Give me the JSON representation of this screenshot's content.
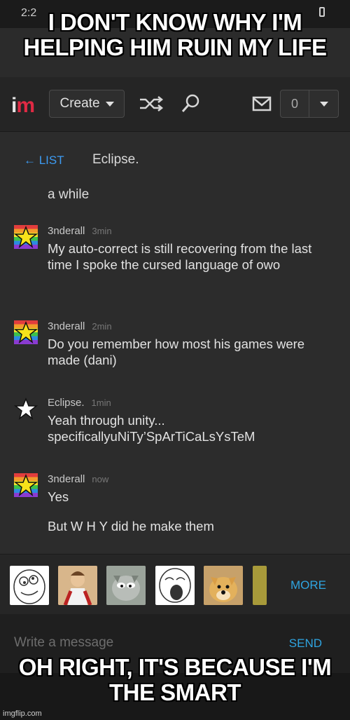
{
  "meme": {
    "top_text": "I DON'T KNOW WHY I'M HELPING HIM RUIN MY LIFE",
    "bottom_text": "OH RIGHT, IT'S BECAUSE I'M THE SMART",
    "watermark": "imgflip.com"
  },
  "statusbar": {
    "time": "2:2"
  },
  "navbar": {
    "logo_i": "i",
    "logo_m": "m",
    "create_label": "Create",
    "notification_count": "0",
    "icons": [
      "shuffle-icon",
      "search-icon",
      "mail-icon",
      "chevron-down-icon"
    ]
  },
  "chat": {
    "back_label": "← LIST",
    "title": "Eclipse.",
    "previous_text": "a while",
    "messages": [
      {
        "user": "3nderall",
        "time": "3min",
        "avatar": "rainbow-star",
        "text": "My auto-correct is still recovering from the last time I spoke the cursed language of owo"
      },
      {
        "user": "3nderall",
        "time": "2min",
        "avatar": "rainbow-star",
        "text": "Do you remember how most his games were made (dani)"
      },
      {
        "user": "Eclipse.",
        "time": "1min",
        "avatar": "white-star",
        "text": "Yeah through unity... specificallyuNiTy’SpArTiCaLsYsTeM"
      },
      {
        "user": "3nderall",
        "time": "now",
        "avatar": "rainbow-star",
        "text": "Yes",
        "text2": "But W H Y did he make them"
      }
    ]
  },
  "reaction_tray": {
    "thumbs": [
      "derp-face",
      "buddy-christ",
      "tom-cat",
      "lol-face",
      "doge",
      "partial-image"
    ],
    "more_label": "MORE"
  },
  "composer": {
    "placeholder": "Write a message",
    "send_label": "SEND"
  },
  "colors": {
    "accent_blue": "#3d9bf2",
    "logo_red": "#e02a44",
    "background": "#2c2c2c"
  }
}
